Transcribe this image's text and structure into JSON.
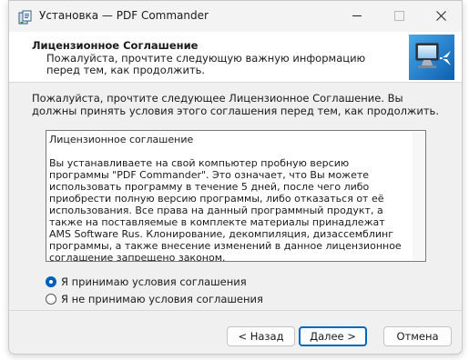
{
  "window": {
    "title": "Установка — PDF Commander"
  },
  "header": {
    "title": "Лицензионное Соглашение",
    "subtitle": "Пожалуйста, прочтите следующую важную информацию перед тем, как продолжить."
  },
  "body": {
    "intro": "Пожалуйста, прочтите следующее Лицензионное Соглашение. Вы должны принять условия этого соглашения перед тем, как продолжить.",
    "license_heading": "Лицензионное соглашение",
    "license_text": "Вы устанавливаете на свой компьютер пробную версию программы \"PDF Commander\". Это означает, что Вы можете использовать программу в течение 5 дней, после чего либо приобрести полную версию программы, либо отказаться от её использования. Все права на данный программный продукт, а также на поставляемые в комплекте материалы принадлежат AMS Software Rus. Клонирование, декомпиляция, дизассемблинг программы, а также внесение изменений в данное лицензионное соглашение запрещено законом."
  },
  "options": {
    "accept_label": "Я принимаю условия соглашения",
    "decline_label": "Я не принимаю условия соглашения",
    "selected": "accept"
  },
  "buttons": {
    "back": "< Назад",
    "next": "Далее >",
    "cancel": "Отмена"
  },
  "colors": {
    "accent": "#0067c0",
    "radio_selected": "#005fb8"
  },
  "icons": {
    "app": "installer-app-icon",
    "header": "computer-monitor-arrow-icon",
    "minimize": "minimize-icon",
    "maximize": "maximize-icon",
    "close": "close-icon"
  }
}
